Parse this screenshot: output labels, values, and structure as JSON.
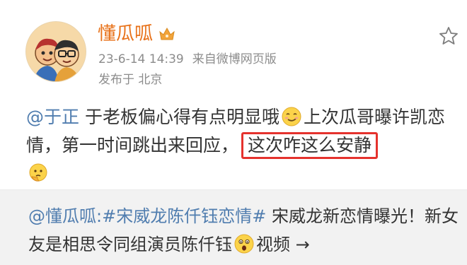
{
  "post": {
    "author": "懂瓜呱",
    "author_badge_icon": "crown-icon",
    "timestamp": "23-6-14 14:39",
    "source": "来自微博网页版",
    "location": "发布于 北京",
    "favorite_icon": "star-outline-icon",
    "content": {
      "mention": "@于正",
      "text_before_emoji": " 于老板偏心得有点明显哦",
      "emoji_1": "smirk-emoji-icon",
      "text_after_emoji": "上次瓜哥曝许凯恋情，第一时间跳出来回应，",
      "highlighted": "这次咋这么安静",
      "emoji_2": "thinking-emoji-icon"
    }
  },
  "repost": {
    "user": "@懂瓜呱:",
    "hashtag": "#宋威龙陈仟钰恋情#",
    "text_1": " 宋威龙新恋情曝光！新女友是相思令同组演员陈仟钰",
    "emoji": "shocked-emoji-icon",
    "text_2": "视频 →"
  },
  "colors": {
    "username": "#e8721a",
    "link": "#507daf",
    "meta": "#8c8c8c",
    "highlight_border": "#e5322d",
    "repost_bg": "#f2f2f2"
  }
}
